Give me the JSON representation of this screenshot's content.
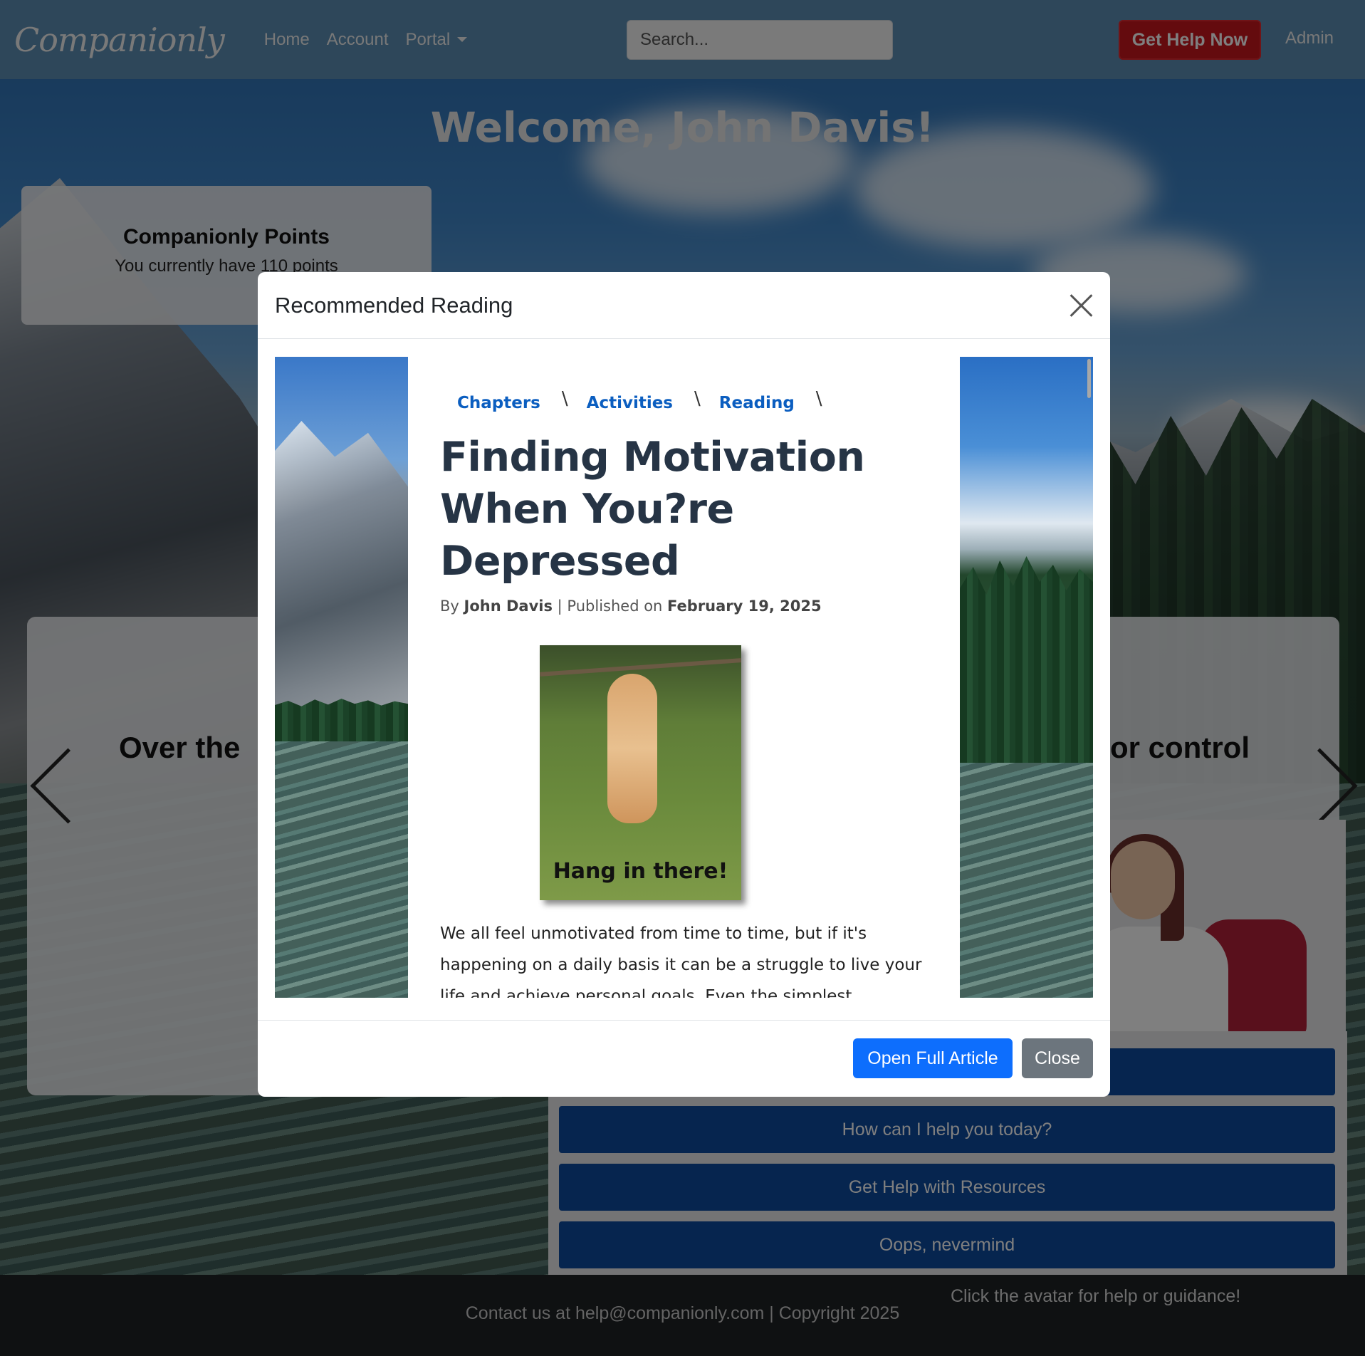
{
  "navbar": {
    "brand": "Companionly",
    "links": [
      "Home",
      "Account",
      "Portal"
    ],
    "search_placeholder": "Search...",
    "help_button": "Get Help Now",
    "admin_link": "Admin"
  },
  "page": {
    "welcome": "Welcome, John Davis!",
    "points_title": "Companionly Points",
    "points_text": "You currently have 110 points",
    "carousel_left_title": "Over the",
    "carousel_right_title": "or control"
  },
  "chat": {
    "options": [
      "How can I help you today?",
      "Get Help with Resources",
      "Oops, nevermind"
    ],
    "hint": "Click the avatar for help or guidance!"
  },
  "footer": {
    "text": "Contact us at help@companionly.com | Copyright 2025"
  },
  "modal": {
    "title": "Recommended Reading",
    "crumbs": [
      "Chapters",
      "Activities",
      "Reading"
    ],
    "article_title": "Finding Motivation When You?re Depressed",
    "byline_prefix": "By",
    "author": "John Davis",
    "published_label": "| Published on",
    "date": "February 19, 2025",
    "image_caption": "Hang in there!",
    "body": "We all feel unmotivated from time to time, but if it's happening on a daily basis it can be a struggle to live your life and achieve personal goals. Even the simplest",
    "primary_button": "Open Full Article",
    "close_button": "Close"
  }
}
